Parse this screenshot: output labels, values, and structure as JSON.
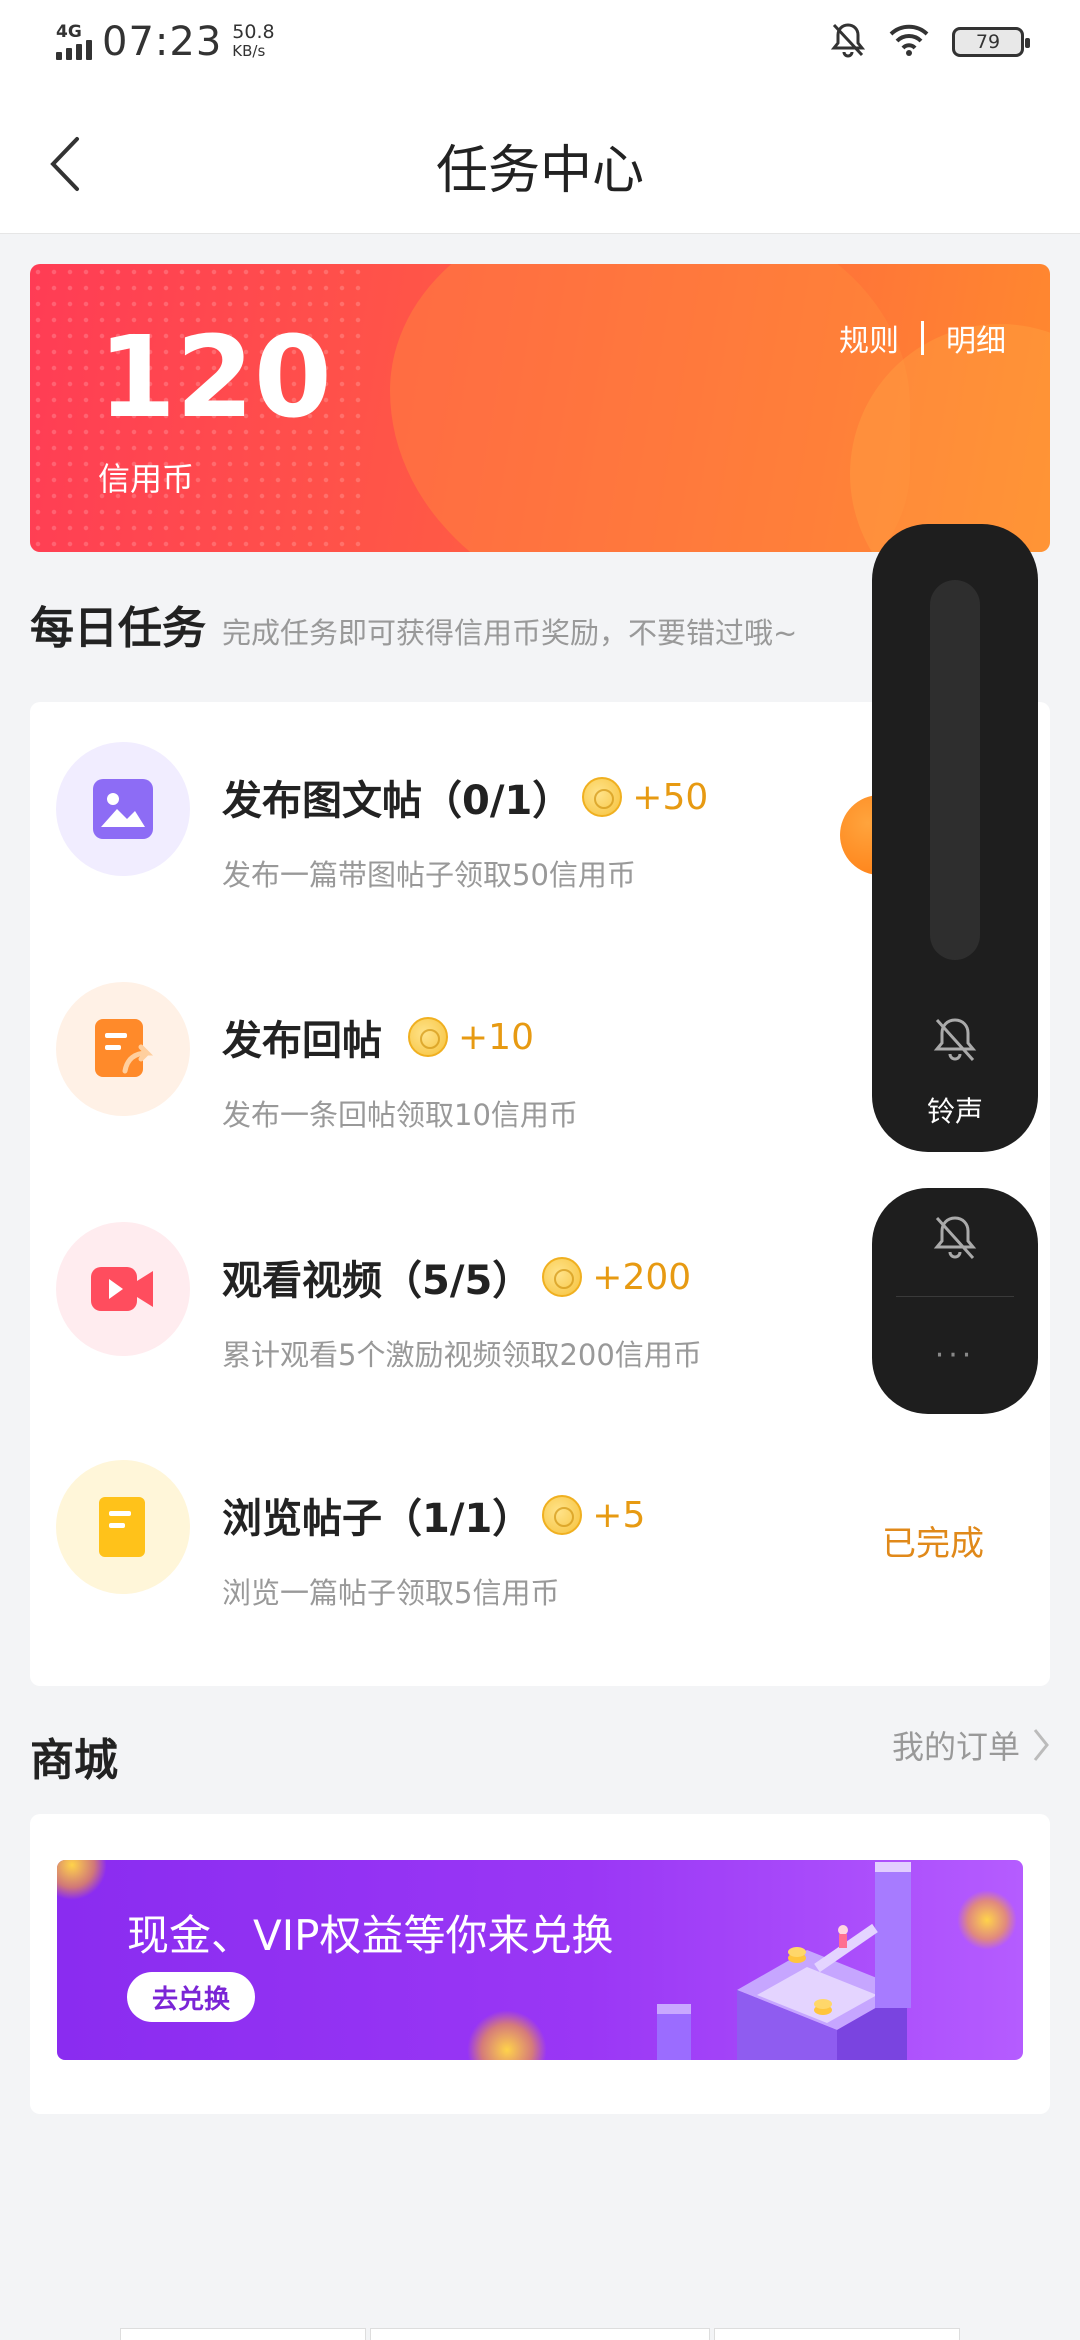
{
  "status_bar": {
    "network": "4G",
    "time": "07:23",
    "speed_value": "50.8",
    "speed_unit": "KB/s",
    "battery": "79"
  },
  "nav": {
    "title": "任务中心"
  },
  "banner": {
    "balance": "120",
    "balance_label": "信用币",
    "rules_link": "规则",
    "detail_link": "明细"
  },
  "daily": {
    "title": "每日任务",
    "subtitle": "完成任务即可获得信用币奖励，不要错过哦~",
    "tasks": [
      {
        "title": "发布图文帖（0/1）",
        "reward": "+50",
        "desc": "发布一篇带图帖子领取50信用币",
        "status": ""
      },
      {
        "title": "发布回帖",
        "reward": "+10",
        "desc": "发布一条回帖领取10信用币",
        "status": ""
      },
      {
        "title": "观看视频（5/5）",
        "reward": "+200",
        "desc": "累计观看5个激励视频领取200信用币",
        "status": ""
      },
      {
        "title": "浏览帖子（1/1）",
        "reward": "+5",
        "desc": "浏览一篇帖子领取5信用币",
        "status": "已完成"
      }
    ]
  },
  "shop": {
    "title": "商城",
    "orders_link": "我的订单",
    "promo_text": "现金、VIP权益等你来兑换",
    "promo_button": "去兑换"
  },
  "volume_overlay": {
    "ring_label": "铃声",
    "more_label": "···"
  },
  "colors": {
    "accent": "#ff5a45",
    "reward": "#e79a12",
    "promo": "#8a2cf0"
  }
}
